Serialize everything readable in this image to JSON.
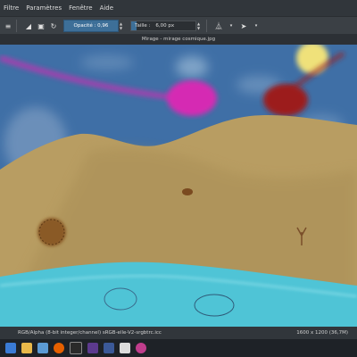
{
  "menu": [
    "Filtre",
    "Paramètres",
    "Fenêtre",
    "Aide"
  ],
  "toolbar": {
    "opacity_label": "Opacité : 0,96",
    "opacity_value": 0.96,
    "size_label": "Taille :",
    "size_value": "6,00 px"
  },
  "document_tab": "Mirage - mirage cosmique.jpg",
  "status": {
    "color_profile": "RGB/Alpha (8-bit integer/channel)  sRGB-elle-V2-srgbtrc.icc",
    "dimensions": "1600 x 1200 (36,7M)"
  },
  "colors": {
    "sky": "#3f6fa6",
    "sand": "#b89d62",
    "water": "#4fc4d6",
    "magenta": "#d52ab3",
    "red": "#9c1b1c",
    "sun": "#efe17a",
    "accent": "#3d6f98"
  },
  "taskbar_icons": [
    "start-icon",
    "folder-icon",
    "shield-icon",
    "firefox-icon",
    "app-icon",
    "krita-icon",
    "app-icon-2",
    "image-icon",
    "browser-icon"
  ]
}
